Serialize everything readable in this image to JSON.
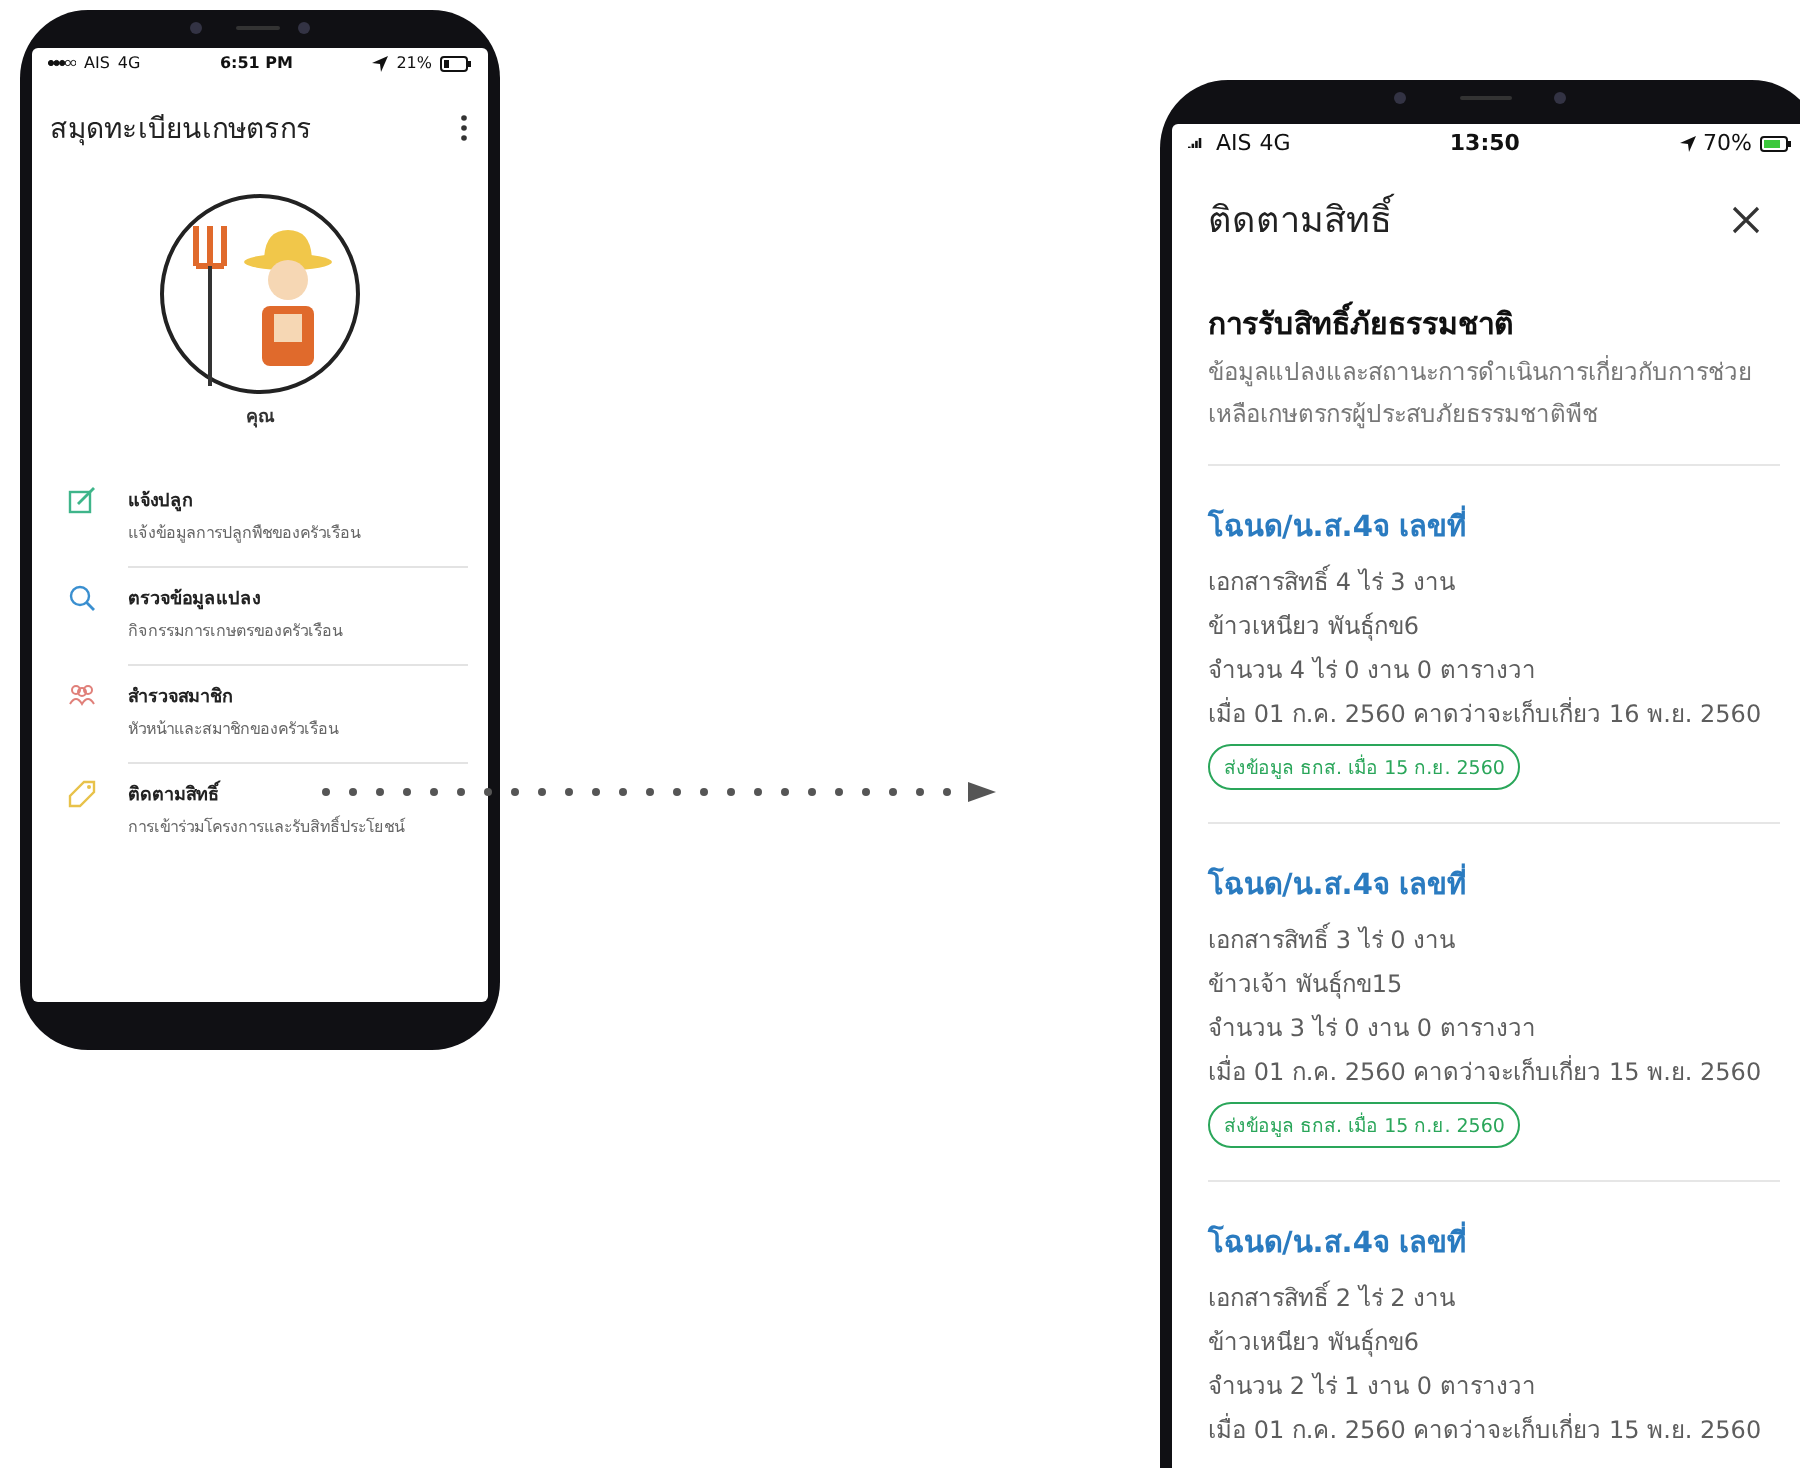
{
  "left_phone": {
    "status_bar": {
      "carrier": "AIS",
      "network": "4G",
      "time": "6:51 PM",
      "battery": "21%"
    },
    "app_bar": {
      "title": "สมุดทะเบียนเกษตรกร"
    },
    "profile": {
      "name": "คุณ"
    },
    "menu": [
      {
        "kind": "edit",
        "title": "แจ้งปลูก",
        "subtitle": "แจ้งข้อมูลการปลูกพืชของครัวเรือน"
      },
      {
        "kind": "search",
        "title": "ตรวจข้อมูลแปลง",
        "subtitle": "กิจกรรมการเกษตรของครัวเรือน"
      },
      {
        "kind": "members",
        "title": "สำรวจสมาชิก",
        "subtitle": "หัวหน้าและสมาชิกของครัวเรือน"
      },
      {
        "kind": "tag",
        "title": "ติดตามสิทธิ์",
        "subtitle": "การเข้าร่วมโครงการและรับสิทธิ์ประโยชน์"
      }
    ]
  },
  "right_phone": {
    "status_bar": {
      "carrier": "AIS",
      "network": "4G",
      "time": "13:50",
      "battery": "70%"
    },
    "app_bar": {
      "title": "ติดตามสิทธิ์"
    },
    "section": {
      "title": "การรับสิทธิ์ภัยธรรมชาติ",
      "description": "ข้อมูลแปลงและสถานะการดำเนินการเกี่ยวกับการช่วยเหลือเกษตรกรผู้ประสบภัยธรรมชาติพืช"
    },
    "plots": [
      {
        "heading": "โฉนด/น.ส.4จ เลขที่",
        "lines": [
          "เอกสารสิทธิ์ 4 ไร่ 3 งาน",
          "ข้าวเหนียว พันธุ์กข6",
          "จำนวน 4 ไร่ 0 งาน 0 ตารางวา",
          "เมื่อ 01 ก.ค. 2560 คาดว่าจะเก็บเกี่ยว 16 พ.ย. 2560"
        ],
        "status": "ส่งข้อมูล ธกส. เมื่อ 15 ก.ย. 2560"
      },
      {
        "heading": "โฉนด/น.ส.4จ เลขที่",
        "lines": [
          "เอกสารสิทธิ์ 3 ไร่ 0 งาน",
          "ข้าวเจ้า พันธุ์กข15",
          "จำนวน 3 ไร่ 0 งาน 0 ตารางวา",
          "เมื่อ 01 ก.ค. 2560 คาดว่าจะเก็บเกี่ยว 15 พ.ย. 2560"
        ],
        "status": "ส่งข้อมูล ธกส. เมื่อ 15 ก.ย. 2560"
      },
      {
        "heading": "โฉนด/น.ส.4จ เลขที่",
        "lines": [
          "เอกสารสิทธิ์ 2 ไร่ 2 งาน",
          "ข้าวเหนียว พันธุ์กข6",
          "จำนวน 2 ไร่ 1 งาน 0 ตารางวา",
          "เมื่อ 01 ก.ค. 2560 คาดว่าจะเก็บเกี่ยว 15 พ.ย. 2560"
        ]
      }
    ]
  }
}
